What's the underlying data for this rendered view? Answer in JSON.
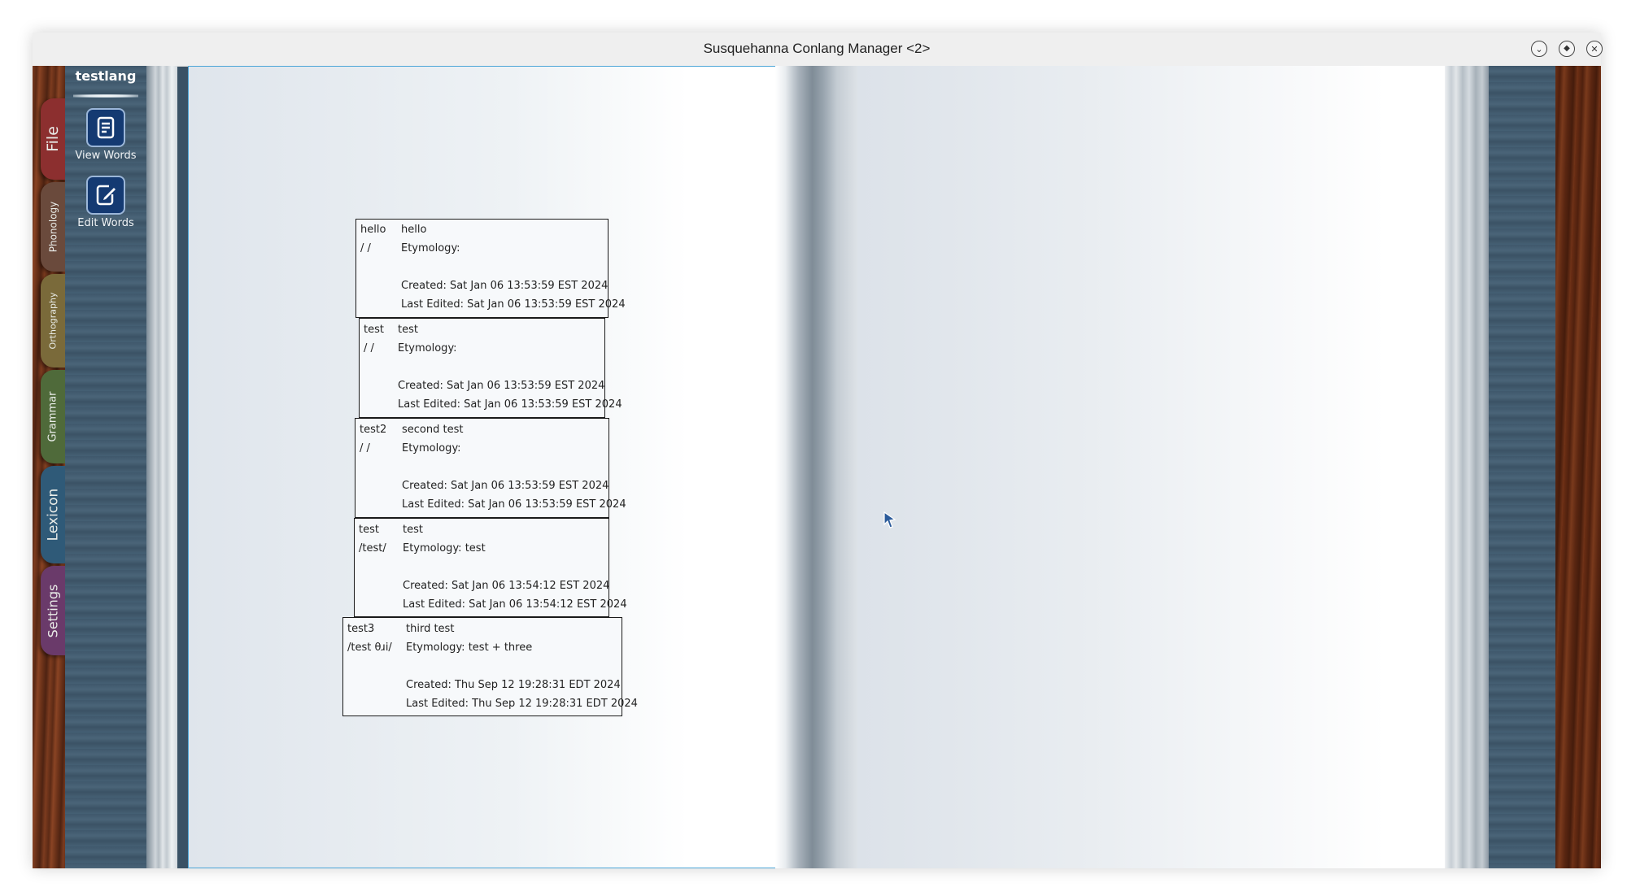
{
  "window": {
    "title": "Susquehanna Conlang Manager <2>"
  },
  "sidebar": {
    "project": "testlang",
    "buttons": [
      {
        "label": "View Words",
        "icon": "view-words-icon"
      },
      {
        "label": "Edit Words",
        "icon": "edit-words-icon"
      }
    ]
  },
  "tabs": [
    {
      "label": "File",
      "color": "#8c2f2f"
    },
    {
      "label": "Phonology",
      "color": "#6a4a3c"
    },
    {
      "label": "Orthography",
      "color": "#7a6a3a"
    },
    {
      "label": "Grammar",
      "color": "#4f6a3a"
    },
    {
      "label": "Lexicon",
      "color": "#2f5a78"
    },
    {
      "label": "Settings",
      "color": "#6a3a6a"
    }
  ],
  "entries": [
    {
      "word": "hello",
      "pron": "/ /",
      "meaning": "hello",
      "etymology": "Etymology:",
      "created": "Created: Sat Jan 06 13:53:59 EST 2024",
      "edited": "Last Edited: Sat Jan 06 13:53:59 EST 2024"
    },
    {
      "word": "test",
      "pron": "/ /",
      "meaning": "test",
      "etymology": "Etymology:",
      "created": "Created: Sat Jan 06 13:53:59 EST 2024",
      "edited": "Last Edited: Sat Jan 06 13:53:59 EST 2024"
    },
    {
      "word": "test2",
      "pron": "/ /",
      "meaning": "second test",
      "etymology": "Etymology:",
      "created": "Created: Sat Jan 06 13:53:59 EST 2024",
      "edited": "Last Edited: Sat Jan 06 13:53:59 EST 2024"
    },
    {
      "word": "test",
      "pron": "/test/",
      "meaning": "test",
      "etymology": "Etymology: test",
      "created": "Created: Sat Jan 06 13:54:12 EST 2024",
      "edited": "Last Edited: Sat Jan 06 13:54:12 EST 2024"
    },
    {
      "word": "test3",
      "pron": "/test θɹi/",
      "meaning": "third test",
      "etymology": "Etymology: test + three",
      "created": "Created: Thu Sep 12 19:28:31 EDT 2024",
      "edited": "Last Edited: Thu Sep 12 19:28:31 EDT 2024"
    }
  ]
}
